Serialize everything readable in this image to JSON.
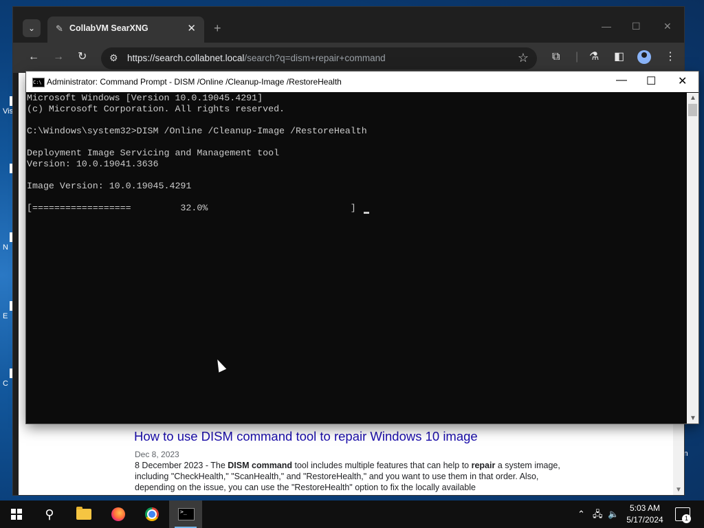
{
  "desktop": {
    "icons": [
      {
        "label": "Vis"
      },
      {
        "label": ""
      },
      {
        "label": "N"
      },
      {
        "label": "E"
      },
      {
        "label": "C"
      }
    ],
    "right_text": "in"
  },
  "browser": {
    "tab_title": "CollabVM SearXNG",
    "tab_close": "✕",
    "new_tab": "+",
    "url_host": "https://search.collabnet.local",
    "url_path": "/search?q=dism+repair+command",
    "window_controls": {
      "minimize": "—",
      "maximize": "☐",
      "close": "✕"
    }
  },
  "console": {
    "title": "Administrator: Command Prompt - DISM  /Online /Cleanup-Image /RestoreHealth",
    "lines": [
      "Microsoft Windows [Version 10.0.19045.4291]",
      "(c) Microsoft Corporation. All rights reserved.",
      "",
      "C:\\Windows\\system32>DISM /Online /Cleanup-Image /RestoreHealth",
      "",
      "Deployment Image Servicing and Management tool",
      "Version: 10.0.19041.3636",
      "",
      "Image Version: 10.0.19045.4291",
      "",
      "[==================         32.0%                          ]"
    ],
    "progress_percent": 32.0,
    "controls": {
      "minimize": "—",
      "maximize": "☐",
      "close": "✕"
    }
  },
  "search_result": {
    "title": "How to use DISM command tool to repair Windows 10 image",
    "date": "Dec 8, 2023",
    "snippet_parts": [
      {
        "text": "8 December 2023 - The ",
        "bold": false
      },
      {
        "text": "DISM command",
        "bold": true
      },
      {
        "text": " tool includes multiple features that can help to ",
        "bold": false
      },
      {
        "text": "repair",
        "bold": true
      },
      {
        "text": " a system image, including \"CheckHealth,\" \"ScanHealth,\" and \"RestoreHealth,\" and you want to use them in that order. Also, depending on the issue, you can use the \"RestoreHealth\" option to fix the locally available",
        "bold": false
      }
    ]
  },
  "taskbar": {
    "apps": [
      {
        "name": "start",
        "icon": "windows-logo"
      },
      {
        "name": "search",
        "icon": "search-icon"
      },
      {
        "name": "file-explorer",
        "icon": "folder-icon"
      },
      {
        "name": "firefox",
        "icon": "firefox-icon"
      },
      {
        "name": "chrome",
        "icon": "chrome-icon"
      },
      {
        "name": "command-prompt",
        "icon": "cmd-icon"
      }
    ],
    "clock_time": "5:03 AM",
    "clock_date": "5/17/2024",
    "notification_count": "1"
  },
  "colors": {
    "console_bg": "#0c0c0c",
    "console_text": "#cccccc",
    "link": "#1a0dab"
  }
}
